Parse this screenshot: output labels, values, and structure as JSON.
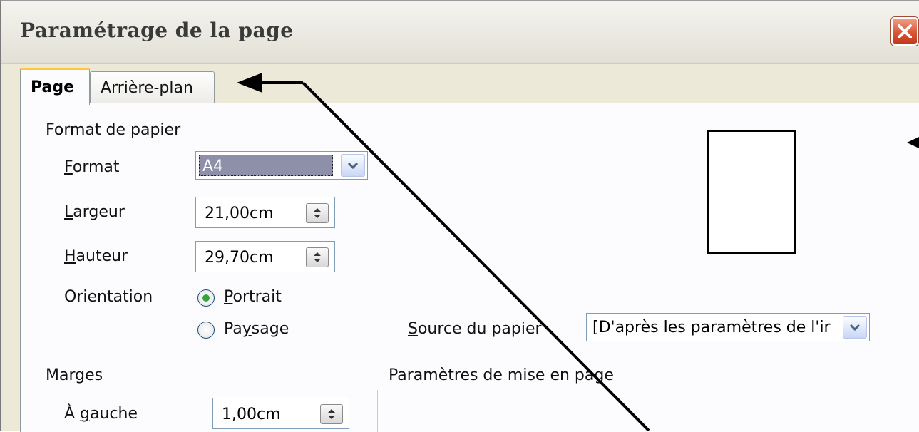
{
  "window": {
    "title": "Paramétrage de la page"
  },
  "tabs": [
    {
      "label": "Page",
      "active": true
    },
    {
      "label": "Arrière-plan",
      "active": false
    }
  ],
  "paper_format": {
    "group_label": "Format de papier",
    "format": {
      "label_u": "F",
      "label_rest": "ormat",
      "value": "A4"
    },
    "width": {
      "label_u": "L",
      "label_rest": "argeur",
      "value": "21,00cm"
    },
    "height": {
      "label_u": "H",
      "label_rest": "auteur",
      "value": "29,70cm"
    },
    "orientation": {
      "label": "Orientation",
      "portrait_u": "P",
      "portrait_rest": "ortrait",
      "landscape_pre": "Pa",
      "landscape_u": "y",
      "landscape_rest": "sage",
      "selected": "Portrait"
    },
    "paper_source": {
      "label_u": "S",
      "label_rest": "ource du papier",
      "value": "[D'après les paramètres de l'ir"
    }
  },
  "margins": {
    "group_label": "Marges",
    "left": {
      "label_pre": "À ",
      "label_u": "g",
      "label_rest": "auche",
      "value": "1,00cm"
    }
  },
  "layout_settings": {
    "group_label": "Paramètres de mise en page"
  },
  "colors": {
    "close_button": "#d95535",
    "tab_highlight": "#ffc83c",
    "field_border": "#7f9db9"
  }
}
